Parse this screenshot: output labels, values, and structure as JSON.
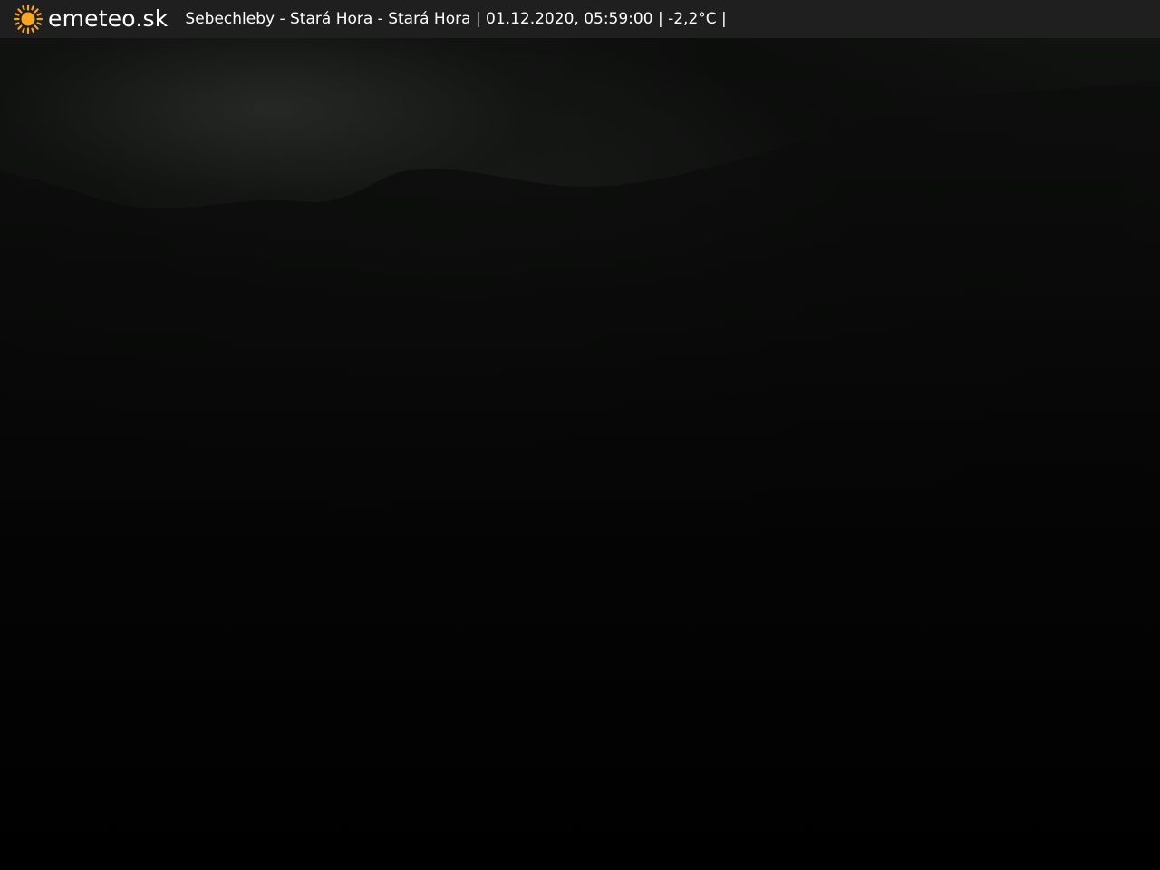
{
  "header": {
    "brand": "emeteo.sk",
    "brand_icon": "sun-icon",
    "location": "Sebechleby - Stará Hora - Stará Hora",
    "separator": "|",
    "datetime": "01.12.2020, 05:59:00",
    "temperature": "-2,2°C"
  },
  "colors": {
    "bar_background": "#1f1f1f",
    "sun": "#f5a623",
    "text": "#ffffff"
  }
}
